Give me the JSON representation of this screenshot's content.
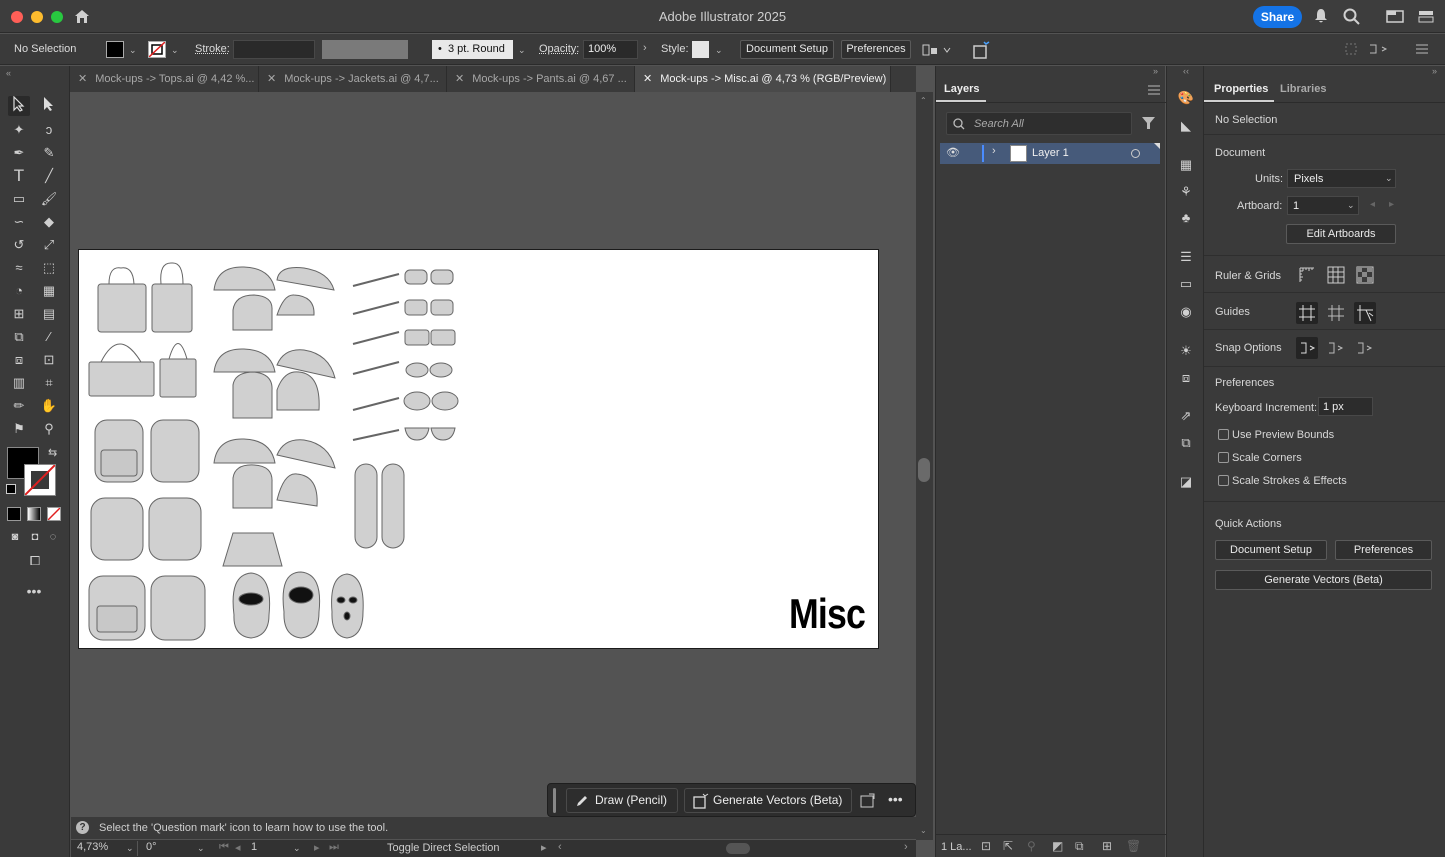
{
  "window": {
    "title": "Adobe Illustrator 2025",
    "share_label": "Share"
  },
  "control_bar": {
    "selection": "No Selection",
    "stroke_label": "Stroke:",
    "brush": "3 pt. Round",
    "opacity_label": "Opacity:",
    "opacity_value": "100%",
    "style_label": "Style:",
    "document_setup": "Document Setup",
    "preferences": "Preferences"
  },
  "tabs": [
    {
      "label": "Mock-ups -> Tops.ai @ 4,42 %...",
      "active": false
    },
    {
      "label": "Mock-ups -> Jackets.ai @ 4,7...",
      "active": false
    },
    {
      "label": "Mock-ups -> Pants.ai @ 4,67 ...",
      "active": false
    },
    {
      "label": "Mock-ups -> Misc.ai @ 4,73 % (RGB/Preview)",
      "active": true
    }
  ],
  "artboard": {
    "label": "Misc"
  },
  "taskbar": {
    "draw": "Draw (Pencil)",
    "generate": "Generate Vectors (Beta)"
  },
  "status": {
    "hint": "Select the 'Question mark' icon to learn how to use the tool.",
    "zoom": "4,73%",
    "rotation": "0°",
    "artboard_num": "1",
    "tool": "Toggle Direct Selection"
  },
  "layers": {
    "title": "Layers",
    "search_placeholder": "Search All",
    "items": [
      {
        "name": "Layer 1"
      }
    ],
    "footer": "1 La..."
  },
  "properties": {
    "tab_properties": "Properties",
    "tab_libraries": "Libraries",
    "selection": "No Selection",
    "document_header": "Document",
    "units_label": "Units:",
    "units_value": "Pixels",
    "artboard_label": "Artboard:",
    "artboard_value": "1",
    "edit_artboards": "Edit Artboards",
    "ruler_grids": "Ruler & Grids",
    "guides": "Guides",
    "snap_options": "Snap Options",
    "preferences_header": "Preferences",
    "keyboard_increment_label": "Keyboard Increment:",
    "keyboard_increment_value": "1 px",
    "use_preview_bounds": "Use Preview Bounds",
    "scale_corners": "Scale Corners",
    "scale_strokes": "Scale Strokes & Effects",
    "quick_actions": "Quick Actions",
    "qa_document_setup": "Document Setup",
    "qa_preferences": "Preferences",
    "qa_generate": "Generate Vectors (Beta)"
  },
  "colors": {
    "accent": "#1473e6",
    "panel": "#3a3a3a",
    "canvas": "#535353"
  }
}
